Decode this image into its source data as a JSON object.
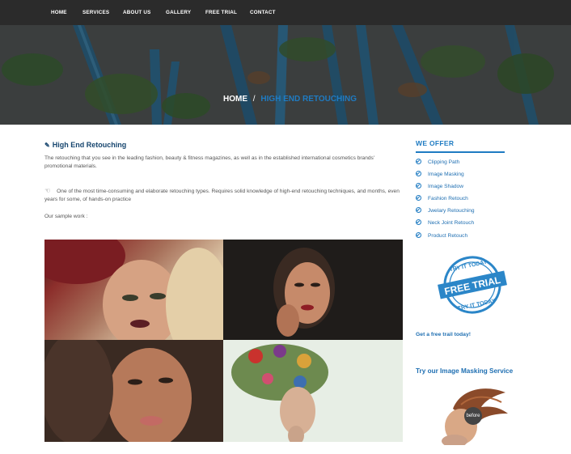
{
  "nav": {
    "items": [
      "HOME",
      "SERVICES",
      "ABOUT US",
      "GALLERY",
      "FREE TRIAL",
      "CONTACT"
    ]
  },
  "breadcrumb": {
    "home": "HOME",
    "separator": "/",
    "current": "HIGH END RETOUCHING"
  },
  "main": {
    "title": "High End Retouching",
    "paragraph1": "The retouching that you see in the leading fashion, beauty & fitness magazines, as well as in the established international cosmetics brands' promotional materials.",
    "paragraph2": "One of the most time-consuming and elaborate retouching types. Requires solid knowledge of high-end retouching techniques, and months, even years for some, of hands-on practice",
    "paragraph3": "Our sample work :"
  },
  "sidebar": {
    "offer_title": "WE OFFER",
    "offer_items": [
      "Clipping Path",
      "Image Masking",
      "Image Shadow",
      "Fashion Retouch",
      "Jwelary Retouching",
      "Neck Joint Retouch",
      "Product Retouch"
    ],
    "stamp": {
      "top": "TRY IT TODAY",
      "center": "FREE TRIAL",
      "bottom": "TRY IT TODAY"
    },
    "free_trail_link": "Get a free trail today!",
    "masking_title": "Try our Image Masking Service",
    "before_label": "before"
  },
  "colors": {
    "nav_bg": "#2b2b2b",
    "accent_blue": "#1f7bc2",
    "title_dark_blue": "#16456e"
  }
}
